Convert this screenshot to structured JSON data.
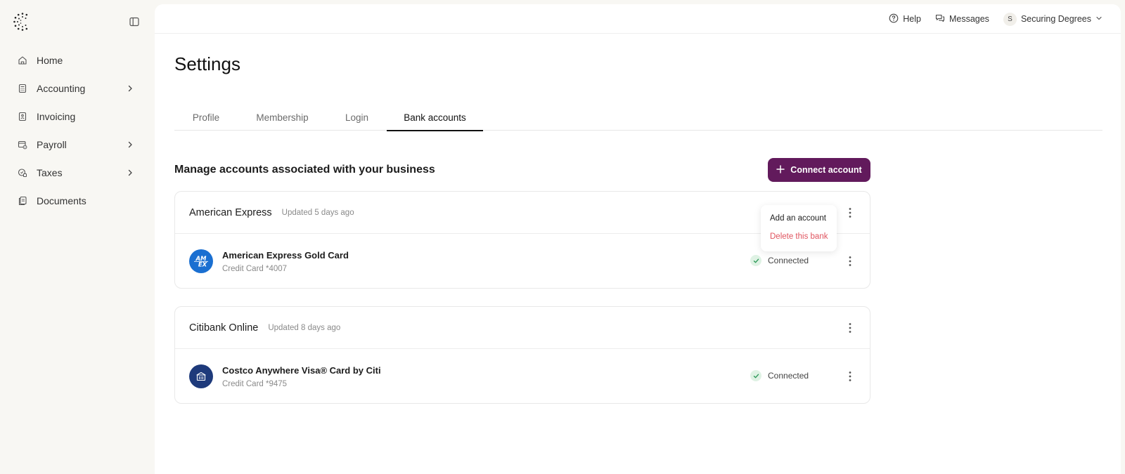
{
  "sidebar": {
    "items": [
      {
        "label": "Home",
        "icon": "home-icon",
        "has_children": false
      },
      {
        "label": "Accounting",
        "icon": "calculator-icon",
        "has_children": true
      },
      {
        "label": "Invoicing",
        "icon": "invoice-icon",
        "has_children": false
      },
      {
        "label": "Payroll",
        "icon": "payroll-icon",
        "has_children": true
      },
      {
        "label": "Taxes",
        "icon": "taxes-icon",
        "has_children": true
      },
      {
        "label": "Documents",
        "icon": "documents-icon",
        "has_children": false
      }
    ]
  },
  "topbar": {
    "help_label": "Help",
    "messages_label": "Messages",
    "avatar_initial": "S",
    "user_name": "Securing Degrees"
  },
  "page": {
    "title": "Settings",
    "tabs": [
      {
        "label": "Profile",
        "active": false
      },
      {
        "label": "Membership",
        "active": false
      },
      {
        "label": "Login",
        "active": false
      },
      {
        "label": "Bank accounts",
        "active": true
      }
    ],
    "section_title": "Manage accounts associated with your business",
    "connect_label": "Connect account"
  },
  "banks": [
    {
      "name": "American Express",
      "updated": "Updated 5 days ago",
      "accounts": [
        {
          "name": "American Express Gold Card",
          "sub": "Credit Card *4007",
          "status": "Connected",
          "logo": "amex-logo",
          "logo_text": "AM EX",
          "logo_color": "#1a6fd1"
        }
      ]
    },
    {
      "name": "Citibank Online",
      "updated": "Updated 8 days ago",
      "accounts": [
        {
          "name": "Costco Anywhere Visa® Card by Citi",
          "sub": "Credit Card *9475",
          "status": "Connected",
          "logo": "bank-building-icon",
          "logo_color": "#1e3a7b"
        }
      ]
    }
  ],
  "dropdown": {
    "add_label": "Add an account",
    "delete_label": "Delete this bank"
  },
  "colors": {
    "brand": "#621a5c",
    "danger": "#e0545f",
    "connected_bg": "#dff2e4",
    "connected_check": "#2e9a5a"
  }
}
